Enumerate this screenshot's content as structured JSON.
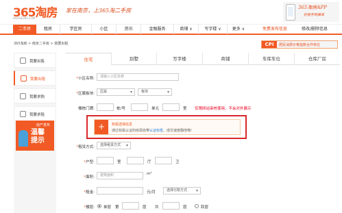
{
  "header": {
    "logo": "365淘房",
    "logo_sub": "HOUSE365.COM",
    "slogan": "家在南京，上365淘二手房",
    "app_line1": "365淘房APP",
    "app_line2": "好房手到擒来"
  },
  "nav": {
    "items": [
      "二手房",
      "租房",
      "学区房",
      "小区",
      "资讯",
      "金融服务",
      "商铺 ∨",
      "写字楼 ∨",
      "更多 ∨"
    ],
    "free_post": "免费发布信息",
    "edit_delete": "修改/删除信息"
  },
  "breadcrumb": "365淘房 > 南京二手房 > 我要出租",
  "cpi": {
    "tag": "CPI",
    "text": "居民消费价格指数合作单位"
  },
  "sidebar": {
    "items": [
      "我要出售",
      "我要出租",
      "我要求购",
      "我要求租"
    ],
    "ad_line1": "房产发布",
    "ad_line2a": "温馨",
    "ad_line2b": "提示"
  },
  "tabs": [
    "住宅",
    "别墅",
    "写字楼",
    "商铺",
    "车库车位",
    "仓库厂房"
  ],
  "form": {
    "community_label": "小区名称:",
    "community_placeholder": "请输入小区名称",
    "district_label": "区属板块:",
    "district_value": "区属",
    "block_value": "板块",
    "doorplate_label": "楼栋门牌:",
    "unit_building": "栋/号",
    "unit_unit": "单元",
    "unit_room": "室",
    "doorplate_warning": "仅限网站审核使用，不会对外展示",
    "notice_title": "权属选填信息",
    "notice_text_a": "通过权属认证的房源自带",
    "notice_link": "认证标签",
    "notice_text_b": "，成交速度翻倍哦!",
    "rent_type_label": "租赁方式:",
    "rent_type_value": "选择租赁方式",
    "layout_label": "户型:",
    "layout_room": "室",
    "layout_hall": "厅",
    "layout_bath": "卫",
    "area_label": "面积:",
    "area_placeholder": "建筑面积",
    "area_unit": "m²",
    "rent_label": "租金:",
    "rent_unit": "元/月",
    "pay_value": "选择付款方式",
    "floor_label": "楼层:",
    "floor_single": "单层",
    "floor_num": "第",
    "floor_floor": "层",
    "floor_total": "共",
    "floor_floor2": "层",
    "floor_duplex": "跃层"
  },
  "colors": {
    "accent": "#f15a24",
    "warning": "#d8262a",
    "link": "#2a7bd4"
  }
}
